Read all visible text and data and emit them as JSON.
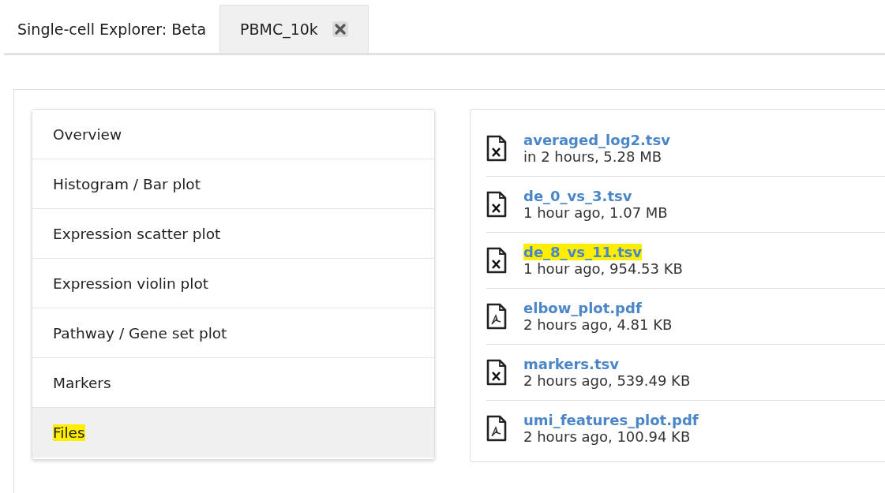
{
  "tabs": [
    {
      "label": "Single-cell Explorer: Beta",
      "selected": false,
      "closable": false
    },
    {
      "label": "PBMC_10k",
      "selected": true,
      "closable": true
    }
  ],
  "sidebar": {
    "items": [
      {
        "label": "Overview",
        "selected": false,
        "highlighted": false
      },
      {
        "label": "Histogram / Bar plot",
        "selected": false,
        "highlighted": false
      },
      {
        "label": "Expression scatter plot",
        "selected": false,
        "highlighted": false
      },
      {
        "label": "Expression violin plot",
        "selected": false,
        "highlighted": false
      },
      {
        "label": "Pathway / Gene set plot",
        "selected": false,
        "highlighted": false
      },
      {
        "label": "Markers",
        "selected": false,
        "highlighted": false
      },
      {
        "label": "Files",
        "selected": true,
        "highlighted": true
      }
    ]
  },
  "files": [
    {
      "name": "averaged_log2.tsv",
      "info": "in 2 hours, 5.28 MB",
      "kind": "spreadsheet",
      "highlighted": false
    },
    {
      "name": "de_0_vs_3.tsv",
      "info": "1 hour ago, 1.07 MB",
      "kind": "spreadsheet",
      "highlighted": false
    },
    {
      "name": "de_8_vs_11.tsv",
      "info": "1 hour ago, 954.53 KB",
      "kind": "spreadsheet",
      "highlighted": true
    },
    {
      "name": "elbow_plot.pdf",
      "info": "2 hours ago, 4.81 KB",
      "kind": "pdf",
      "highlighted": false
    },
    {
      "name": "markers.tsv",
      "info": "2 hours ago, 539.49 KB",
      "kind": "spreadsheet",
      "highlighted": false
    },
    {
      "name": "umi_features_plot.pdf",
      "info": "2 hours ago, 100.94 KB",
      "kind": "pdf",
      "highlighted": false
    }
  ]
}
